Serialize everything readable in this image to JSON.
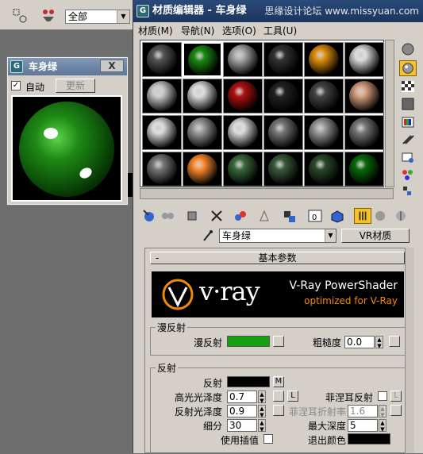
{
  "bg_toolbar": {
    "dropdown_value": "全部"
  },
  "mini_window": {
    "title": "车身绿",
    "close_label": "X",
    "auto_label": "自动",
    "update_label": "更新",
    "auto_checked": true
  },
  "main_window": {
    "title": "材质编辑器 - 车身绿",
    "watermark": "思缘设计论坛 www.missyuan.com",
    "menu": [
      "材质(M)",
      "导航(N)",
      "选项(O)",
      "工具(U)"
    ]
  },
  "toolbar": {
    "material_name": "车身绿",
    "type_button": "VR材质"
  },
  "params": {
    "rollout_title": "基本参数",
    "banner_title": "V-Ray PowerShader",
    "banner_subtitle": "optimized for V-Ray",
    "logo_text": "v·ray",
    "diffuse_group": "漫反射",
    "diffuse_label": "漫反射",
    "diffuse_color": "#15a00f",
    "roughness_label": "粗糙度",
    "roughness_value": "0.0",
    "reflect_group": "反射",
    "reflect_label": "反射",
    "reflect_color": "#000000",
    "reflect_m": "M",
    "hilight_gloss_label": "高光光泽度",
    "hilight_gloss_value": "0.7",
    "lock_l": "L",
    "fresnel_label": "菲涅耳反射",
    "fresnel_l": "L",
    "refl_gloss_label": "反射光泽度",
    "refl_gloss_value": "0.9",
    "fresnel_ior_label": "菲涅耳折射率",
    "fresnel_ior_value": "1.6",
    "subdivs_label": "细分",
    "subdivs_value": "30",
    "max_depth_label": "最大深度",
    "max_depth_value": "5",
    "use_interp_label": "使用插值",
    "exit_color_label": "退出颜色",
    "exit_color": "#000000"
  }
}
